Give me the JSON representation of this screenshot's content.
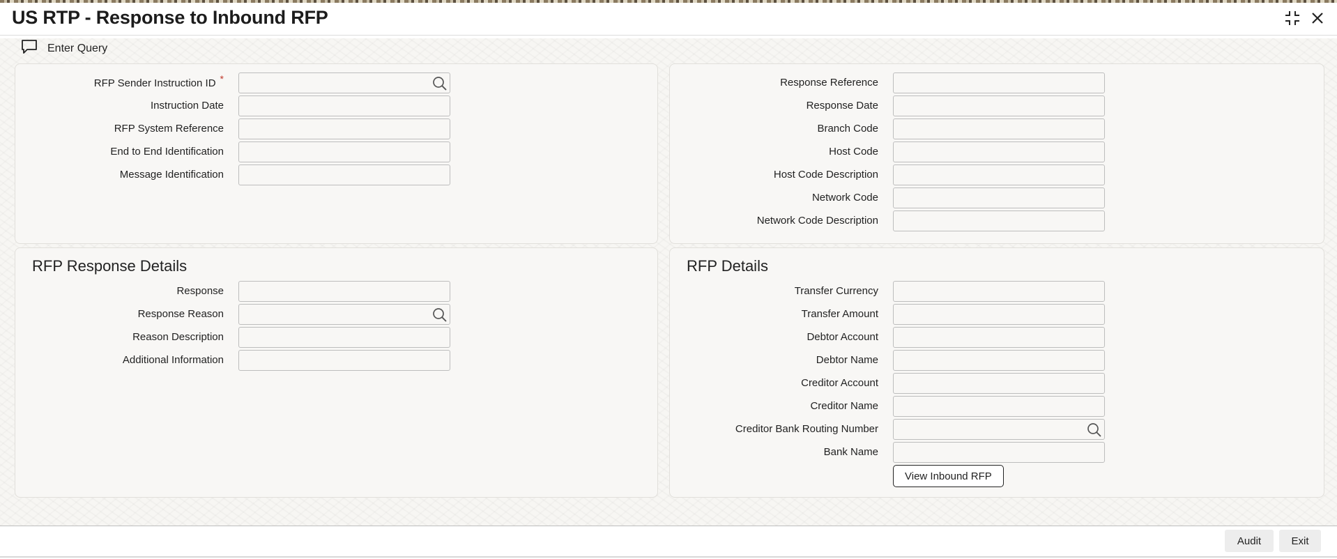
{
  "window": {
    "title": "US RTP - Response to Inbound RFP",
    "maximize_icon": "maximize-icon",
    "close_icon": "close-icon"
  },
  "toolbar": {
    "enter_query_label": "Enter Query",
    "enter_query_icon": "chat-bubble-icon"
  },
  "header_left": {
    "fields": [
      {
        "label": "RFP Sender Instruction ID",
        "value": "",
        "required": true,
        "lookup": true
      },
      {
        "label": "Instruction Date",
        "value": ""
      },
      {
        "label": "RFP System Reference",
        "value": ""
      },
      {
        "label": "End to End Identification",
        "value": ""
      },
      {
        "label": "Message Identification",
        "value": ""
      }
    ],
    "required_marker": "*"
  },
  "header_right": {
    "fields": [
      {
        "label": "Response Reference",
        "value": ""
      },
      {
        "label": "Response Date",
        "value": ""
      },
      {
        "label": "Branch Code",
        "value": ""
      },
      {
        "label": "Host Code",
        "value": ""
      },
      {
        "label": "Host Code Description",
        "value": ""
      },
      {
        "label": "Network Code",
        "value": ""
      },
      {
        "label": "Network Code Description",
        "value": ""
      }
    ]
  },
  "rfp_response_details": {
    "title": "RFP Response Details",
    "fields": [
      {
        "label": "Response",
        "value": ""
      },
      {
        "label": "Response Reason",
        "value": "",
        "lookup": true
      },
      {
        "label": "Reason Description",
        "value": ""
      },
      {
        "label": "Additional Information",
        "value": ""
      }
    ]
  },
  "rfp_details": {
    "title": "RFP Details",
    "fields": [
      {
        "label": "Transfer Currency",
        "value": ""
      },
      {
        "label": "Transfer Amount",
        "value": ""
      },
      {
        "label": "Debtor Account",
        "value": ""
      },
      {
        "label": "Debtor Name",
        "value": ""
      },
      {
        "label": "Creditor Account",
        "value": ""
      },
      {
        "label": "Creditor Name",
        "value": ""
      },
      {
        "label": "Creditor Bank Routing Number",
        "value": "",
        "lookup": true
      },
      {
        "label": "Bank Name",
        "value": ""
      }
    ],
    "view_button_label": "View Inbound RFP"
  },
  "footer": {
    "audit_label": "Audit",
    "exit_label": "Exit"
  },
  "icons": {
    "lookup": "search-icon"
  }
}
